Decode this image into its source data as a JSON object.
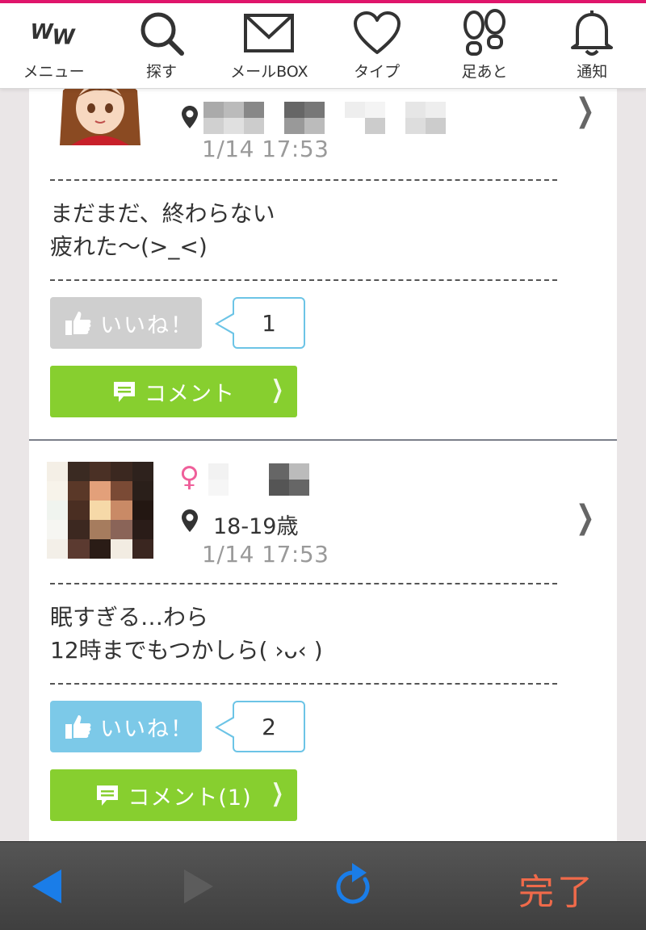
{
  "nav": {
    "items": [
      {
        "label": "メニュー",
        "icon": "ww-logo-icon"
      },
      {
        "label": "探す",
        "icon": "search-icon"
      },
      {
        "label": "メールBOX",
        "icon": "mail-icon"
      },
      {
        "label": "タイプ",
        "icon": "heart-icon"
      },
      {
        "label": "足あと",
        "icon": "footprints-icon"
      },
      {
        "label": "通知",
        "icon": "bell-icon"
      }
    ]
  },
  "posts": [
    {
      "time": "1/14 17:53",
      "text": "まだまだ、終わらない\n疲れた〜(>_<)",
      "like_label": "いいね！",
      "like_state": "inactive",
      "like_count": "1",
      "comment_label": "コメント"
    },
    {
      "gender_symbol": "♀",
      "location": "18-19歳",
      "time": "1/14 17:53",
      "text": "眠すぎる…わら\n12時までもつかしら( ›ᴗ‹ )",
      "like_label": "いいね！",
      "like_state": "active",
      "like_count": "2",
      "comment_label": "コメント(1)"
    }
  ],
  "toolbar": {
    "back_icon": "back-arrow-icon",
    "forward_icon": "forward-arrow-icon",
    "reload_icon": "reload-icon",
    "done_label": "完了"
  },
  "colors": {
    "accent_pink": "#e0156b",
    "like_active": "#7cc9e8",
    "like_inactive": "#cfcfcf",
    "comment_green": "#87cf2f",
    "done_orange": "#f06a4a",
    "ios_blue": "#1a7de8"
  }
}
